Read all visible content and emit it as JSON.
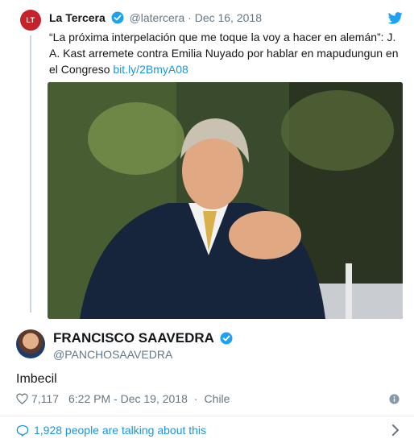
{
  "quoted_tweet": {
    "avatar_text": "LT",
    "name": "La Tercera",
    "handle": "@latercera",
    "separator": "·",
    "date": "Dec 16, 2018",
    "text": "“La próxima interpelación que me toque la voy a hacer en alemán”: J. A. Kast arremete contra Emilia Nuyado por hablar en mapudungun en el Congreso",
    "link": "bit.ly/2BmyA08"
  },
  "reply": {
    "name": "FRANCISCO SAAVEDRA",
    "handle": "@PANCHOSAAVEDRA",
    "text": "Imbecil",
    "likes": "7,117",
    "time": "6:22 PM - Dec 19, 2018",
    "separator": "·",
    "location": "Chile"
  },
  "footer": {
    "talking_text": "1,928 people are talking about this"
  },
  "colors": {
    "link": "#1b95e0",
    "verified": "#1da1f2",
    "brand_red": "#c5232c"
  },
  "icons": [
    "twitter-bird-icon",
    "verified-badge-icon",
    "heart-icon",
    "info-icon",
    "comment-bubble-icon",
    "chevron-right-icon"
  ]
}
